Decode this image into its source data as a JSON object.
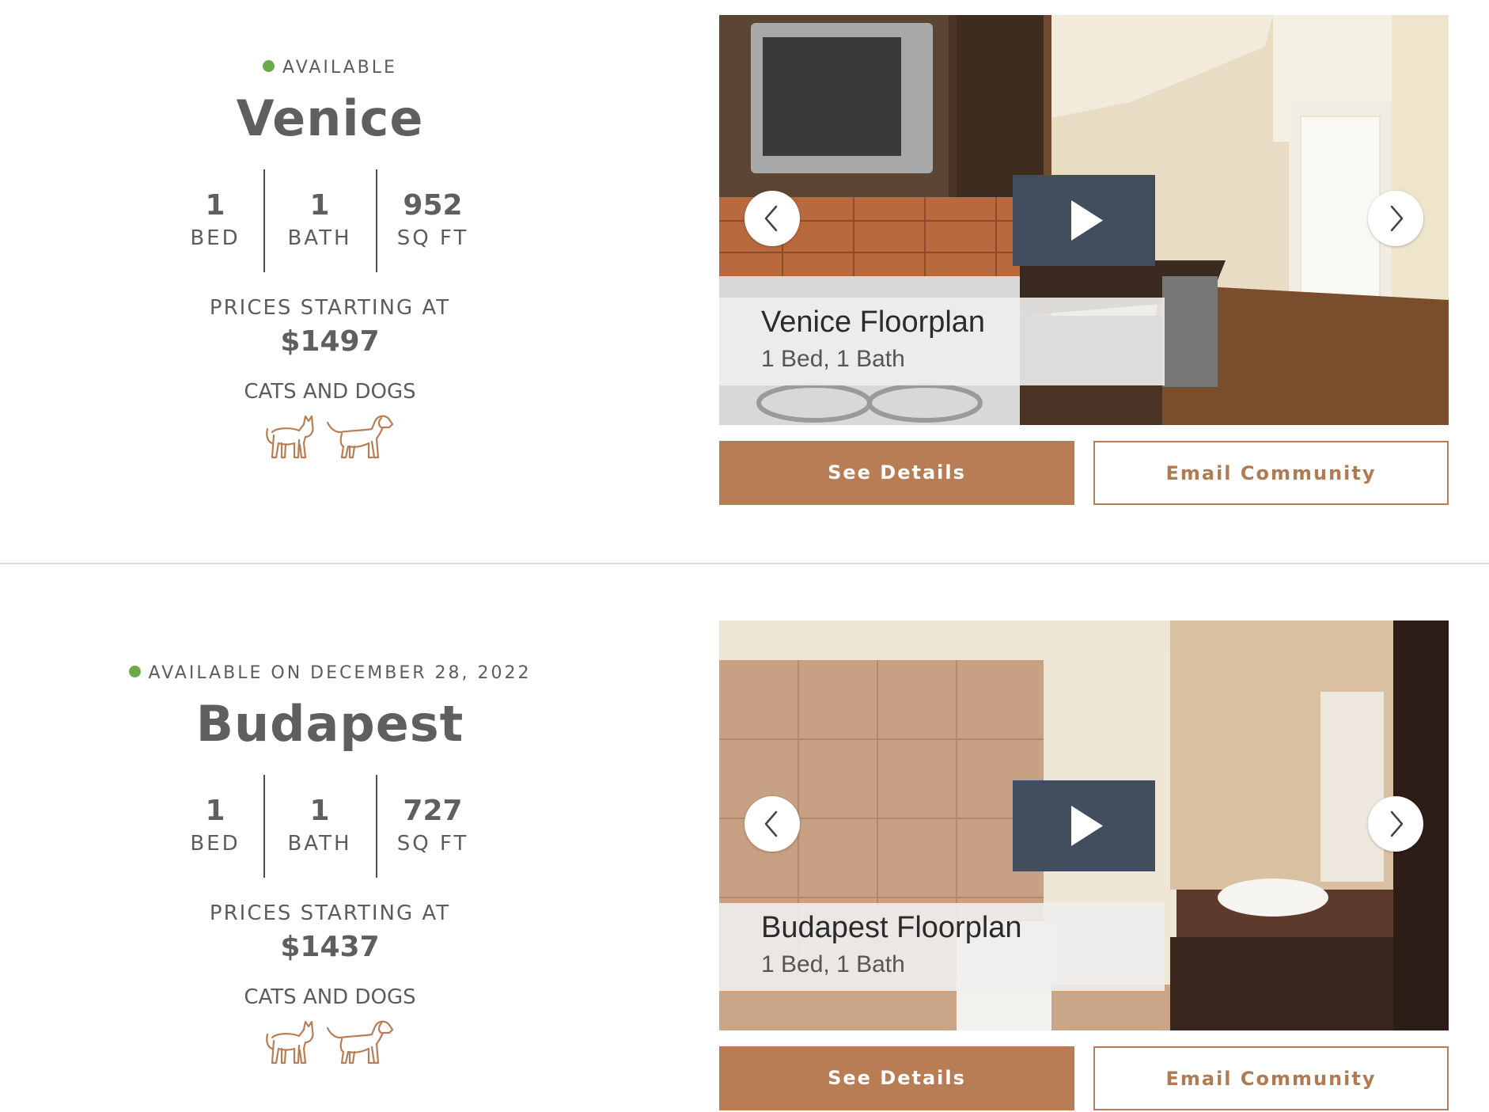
{
  "listings": [
    {
      "status": "AVAILABLE",
      "name": "Venice",
      "stats": [
        {
          "value": "1",
          "unit": "BED"
        },
        {
          "value": "1",
          "unit": "BATH"
        },
        {
          "value": "952",
          "unit": "SQ FT"
        }
      ],
      "price_label": "PRICES STARTING AT",
      "price": "$1497",
      "pets_label": "CATS AND DOGS",
      "caption_title": "Venice Floorplan",
      "caption_subtitle": "1 Bed, 1 Bath",
      "details_label": "See Details",
      "email_label": "Email Community"
    },
    {
      "status": "AVAILABLE ON DECEMBER 28, 2022",
      "name": "Budapest",
      "stats": [
        {
          "value": "1",
          "unit": "BED"
        },
        {
          "value": "1",
          "unit": "BATH"
        },
        {
          "value": "727",
          "unit": "SQ FT"
        }
      ],
      "price_label": "PRICES STARTING AT",
      "price": "$1437",
      "pets_label": "CATS AND DOGS",
      "caption_title": "Budapest Floorplan",
      "caption_subtitle": "1 Bed, 1 Bath",
      "details_label": "See Details",
      "email_label": "Email Community"
    }
  ],
  "icons": {
    "status": "status-dot-icon",
    "cat": "cat-icon",
    "dog": "dog-icon",
    "play": "play-icon",
    "prev": "chevron-left-icon",
    "next": "chevron-right-icon"
  },
  "colors": {
    "accent": "#b87d54",
    "available": "#6cab4c",
    "play_bg": "#424d5d",
    "text": "#5f5f5f"
  }
}
